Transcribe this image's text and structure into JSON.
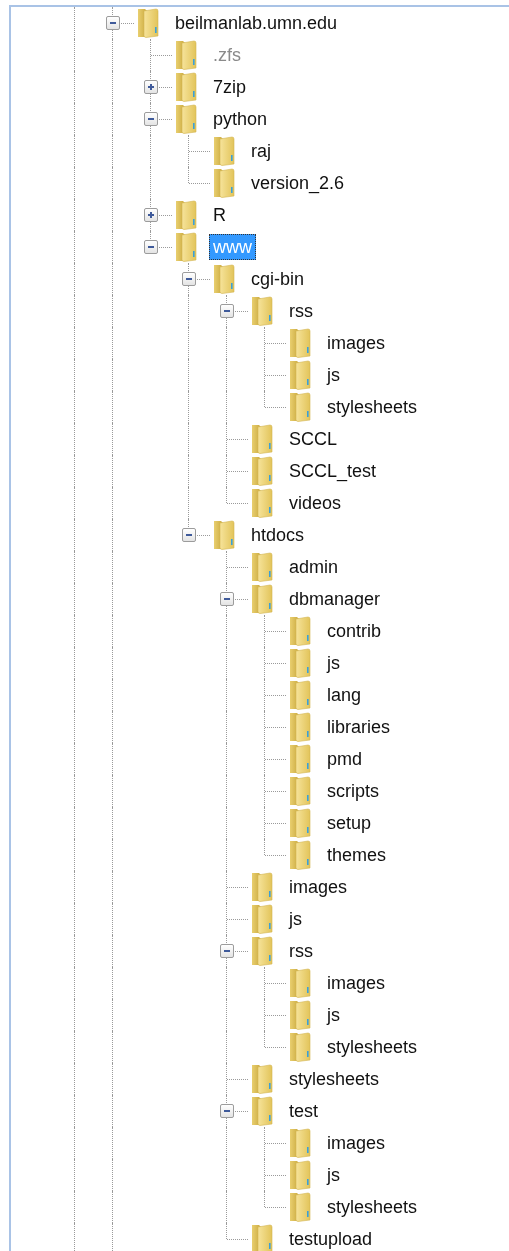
{
  "tree": {
    "items": [
      {
        "label": "beilmanlab.umn.edu",
        "expanded": true,
        "selected": false,
        "hidden": false,
        "children": [
          {
            "label": ".zfs",
            "selected": false,
            "hidden": true
          },
          {
            "label": "7zip",
            "expanded": false,
            "selected": false,
            "hidden": false
          },
          {
            "label": "python",
            "expanded": true,
            "selected": false,
            "hidden": false,
            "children": [
              {
                "label": "raj",
                "selected": false,
                "hidden": false
              },
              {
                "label": "version_2.6",
                "selected": false,
                "hidden": false
              }
            ]
          },
          {
            "label": "R",
            "expanded": false,
            "selected": false,
            "hidden": false
          },
          {
            "label": "www",
            "expanded": true,
            "selected": true,
            "hidden": false,
            "children": [
              {
                "label": "cgi-bin",
                "expanded": true,
                "selected": false,
                "hidden": false,
                "children": [
                  {
                    "label": "rss",
                    "expanded": true,
                    "selected": false,
                    "hidden": false,
                    "children": [
                      {
                        "label": "images",
                        "selected": false,
                        "hidden": false
                      },
                      {
                        "label": "js",
                        "selected": false,
                        "hidden": false
                      },
                      {
                        "label": "stylesheets",
                        "selected": false,
                        "hidden": false
                      }
                    ]
                  },
                  {
                    "label": "SCCL",
                    "selected": false,
                    "hidden": false
                  },
                  {
                    "label": "SCCL_test",
                    "selected": false,
                    "hidden": false
                  },
                  {
                    "label": "videos",
                    "selected": false,
                    "hidden": false
                  }
                ]
              },
              {
                "label": "htdocs",
                "expanded": true,
                "selected": false,
                "hidden": false,
                "children": [
                  {
                    "label": "admin",
                    "selected": false,
                    "hidden": false
                  },
                  {
                    "label": "dbmanager",
                    "expanded": true,
                    "selected": false,
                    "hidden": false,
                    "children": [
                      {
                        "label": "contrib",
                        "selected": false,
                        "hidden": false
                      },
                      {
                        "label": "js",
                        "selected": false,
                        "hidden": false
                      },
                      {
                        "label": "lang",
                        "selected": false,
                        "hidden": false
                      },
                      {
                        "label": "libraries",
                        "selected": false,
                        "hidden": false
                      },
                      {
                        "label": "pmd",
                        "selected": false,
                        "hidden": false
                      },
                      {
                        "label": "scripts",
                        "selected": false,
                        "hidden": false
                      },
                      {
                        "label": "setup",
                        "selected": false,
                        "hidden": false
                      },
                      {
                        "label": "themes",
                        "selected": false,
                        "hidden": false
                      }
                    ]
                  },
                  {
                    "label": "images",
                    "selected": false,
                    "hidden": false
                  },
                  {
                    "label": "js",
                    "selected": false,
                    "hidden": false
                  },
                  {
                    "label": "rss",
                    "expanded": true,
                    "selected": false,
                    "hidden": false,
                    "children": [
                      {
                        "label": "images",
                        "selected": false,
                        "hidden": false
                      },
                      {
                        "label": "js",
                        "selected": false,
                        "hidden": false
                      },
                      {
                        "label": "stylesheets",
                        "selected": false,
                        "hidden": false
                      }
                    ]
                  },
                  {
                    "label": "stylesheets",
                    "selected": false,
                    "hidden": false
                  },
                  {
                    "label": "test",
                    "expanded": true,
                    "selected": false,
                    "hidden": false,
                    "children": [
                      {
                        "label": "images",
                        "selected": false,
                        "hidden": false
                      },
                      {
                        "label": "js",
                        "selected": false,
                        "hidden": false
                      },
                      {
                        "label": "stylesheets",
                        "selected": false,
                        "hidden": false
                      }
                    ]
                  },
                  {
                    "label": "testupload",
                    "selected": false,
                    "hidden": false
                  }
                ]
              }
            ]
          }
        ]
      }
    ]
  }
}
